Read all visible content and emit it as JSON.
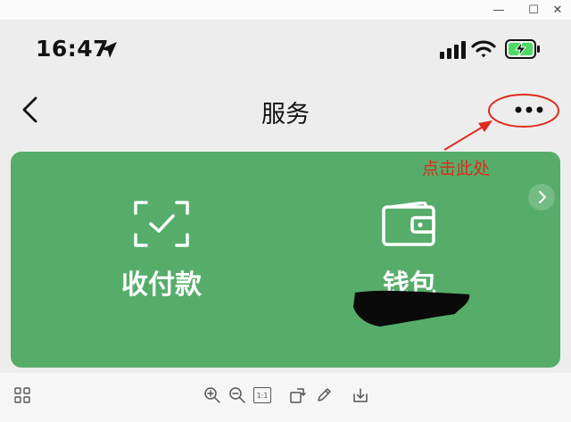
{
  "window": {
    "minimize_icon": "minimize-icon",
    "maximize_icon": "maximize-icon",
    "close_icon": "close-icon",
    "min_glyph": "—",
    "max_glyph": "☐",
    "close_glyph": "✕"
  },
  "status_bar": {
    "time": "16:47",
    "battery_state": "charging",
    "battery_color": "#4cd964"
  },
  "nav": {
    "title": "服务"
  },
  "annotation": {
    "text": "点击此处",
    "color": "#e02a1e"
  },
  "card": {
    "background": "#56ad6a",
    "items": [
      {
        "label": "收付款",
        "icon": "scan-check-icon"
      },
      {
        "label": "钱包",
        "icon": "wallet-icon"
      }
    ]
  },
  "toolbar": {
    "one_to_one_label": "1:1",
    "icons": [
      "grid-icon",
      "zoom-in-icon",
      "zoom-out-icon",
      "actual-size-icon",
      "rotate-icon",
      "edit-icon",
      "download-icon"
    ]
  }
}
